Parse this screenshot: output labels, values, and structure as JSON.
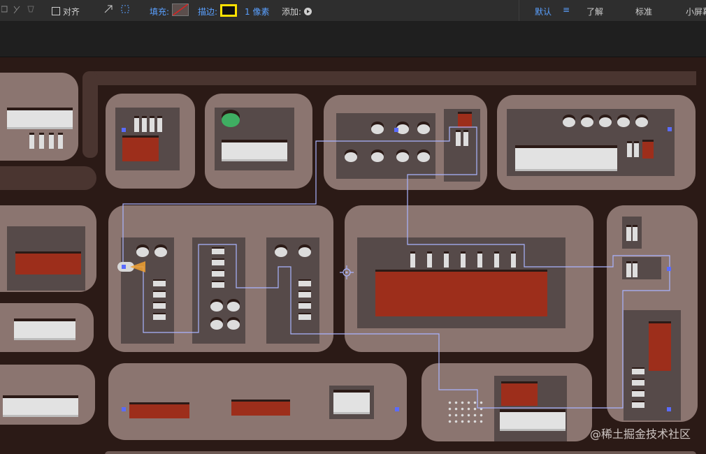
{
  "toolbar": {
    "align_label": "对齐",
    "fill_label": "填充:",
    "stroke_label": "描边:",
    "stroke_width": "1 像素",
    "add_label": "添加:",
    "workspace_default": "默认",
    "menu_glyph": "≡",
    "learn_label": "了解",
    "standard_label": "标准",
    "small_screen_label": "小屏幕",
    "colors": {
      "stroke_swatch": "#ffe100",
      "accent": "#5aa0ff"
    }
  },
  "watermark": "@稀土掘金技术社区",
  "canvas": {
    "colors": {
      "background": "#2b1a16",
      "pad": "#8b7570",
      "board": "#564a49",
      "red": "#9d2e1b",
      "path": "#a9b4ff"
    }
  }
}
